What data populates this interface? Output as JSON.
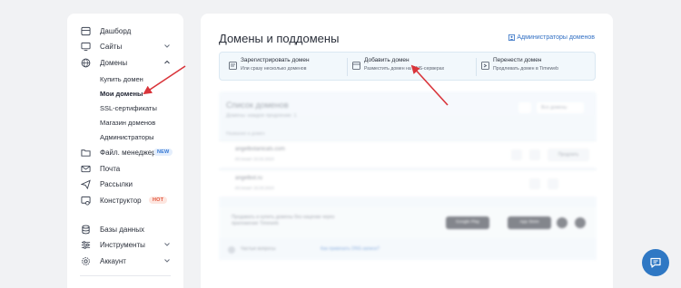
{
  "sidebar": {
    "items": [
      {
        "label": "Дашборд",
        "icon": "dashboard-icon"
      },
      {
        "label": "Сайты",
        "icon": "monitor-icon"
      },
      {
        "label": "Домены",
        "icon": "globe-icon"
      },
      {
        "label": "Файл. менеджер",
        "icon": "folder-icon",
        "badge": "NEW"
      },
      {
        "label": "Почта",
        "icon": "mail-icon"
      },
      {
        "label": "Рассылки",
        "icon": "send-icon"
      },
      {
        "label": "Конструктор",
        "icon": "builder-icon",
        "badge": "HOT"
      },
      {
        "label": "Базы данных",
        "icon": "database-icon"
      },
      {
        "label": "Инструменты",
        "icon": "sliders-icon"
      },
      {
        "label": "Аккаунт",
        "icon": "gear-icon"
      }
    ],
    "domains_sub": [
      "Купить домен",
      "Мои домены",
      "SSL-сертификаты",
      "Магазин доменов",
      "Администраторы"
    ],
    "active_sub": "Мои домены"
  },
  "main": {
    "title": "Домены и поддомены",
    "admin_link": "Администраторы доменов",
    "actions": [
      {
        "title": "Зарегистрировать домен",
        "subtitle": "Или сразу несколько доменов",
        "icon": "register-icon"
      },
      {
        "title": "Добавить домен",
        "subtitle": "Разместить домен на DNS-серверах",
        "icon": "add-domain-icon"
      },
      {
        "title": "Перенести домен",
        "subtitle": "Продлевать домен в Timeweb",
        "icon": "transfer-icon"
      }
    ],
    "list": {
      "title": "Список доменов",
      "subtitle": "Домены: каждое продление: 1",
      "filter_label": "Все домены",
      "column_header": "Название и домен",
      "rows": [
        {
          "domain": "angelbotanicals.com",
          "meta": "Истекает 24.02.2024",
          "button": "Продлить"
        },
        {
          "domain": "angelbot.ru",
          "meta": "Истекает 15.03.2024",
          "button": ""
        }
      ],
      "promo_text": "Продавать и купить домены без наценки через приложение Timeweb",
      "store_google": "Google Play",
      "store_apple": "App Store",
      "footer_text": "Частые вопросы",
      "footer_link": "Как привязать DNS-записи?"
    }
  },
  "colors": {
    "accent": "#3270c4",
    "arrow": "#d9343a",
    "chat": "#2f78c4"
  }
}
